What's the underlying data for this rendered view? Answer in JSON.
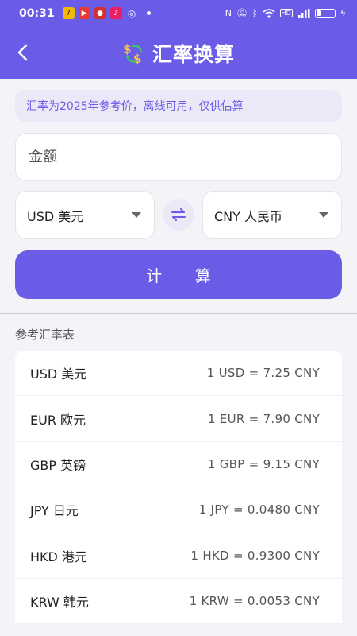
{
  "status_bar": {
    "time": "00:31",
    "icons": [
      "notification-app-icons",
      "nfc-icon",
      "mute-icon",
      "bluetooth-icon",
      "wifi-icon",
      "hd-icon",
      "signal-icon",
      "battery-icon",
      "charging-icon"
    ]
  },
  "header": {
    "title": "汇率换算",
    "icon": "currency-exchange-icon",
    "back_icon": "back-arrow-icon"
  },
  "notice": {
    "text": "汇率为2025年参考价，离线可用，仅供估算"
  },
  "amount_input": {
    "placeholder": "金额",
    "value": ""
  },
  "from_currency": {
    "selected": "USD 美元"
  },
  "to_currency": {
    "selected": "CNY 人民币"
  },
  "calculate_button": {
    "label": "计 算"
  },
  "rates_section": {
    "title": "参考汇率表",
    "rows": [
      {
        "currency": "USD 美元",
        "rate": "1 USD = 7.25 CNY"
      },
      {
        "currency": "EUR 欧元",
        "rate": "1 EUR = 7.90 CNY"
      },
      {
        "currency": "GBP 英镑",
        "rate": "1 GBP = 9.15 CNY"
      },
      {
        "currency": "JPY 日元",
        "rate": "1 JPY = 0.0480 CNY"
      },
      {
        "currency": "HKD 港元",
        "rate": "1 HKD = 0.9300 CNY"
      },
      {
        "currency": "KRW 韩元",
        "rate": "1 KRW = 0.0053 CNY"
      }
    ]
  },
  "colors": {
    "primary": "#6b5ce7",
    "accent_soft": "#ebe9f7",
    "background": "#f4f4f8"
  }
}
